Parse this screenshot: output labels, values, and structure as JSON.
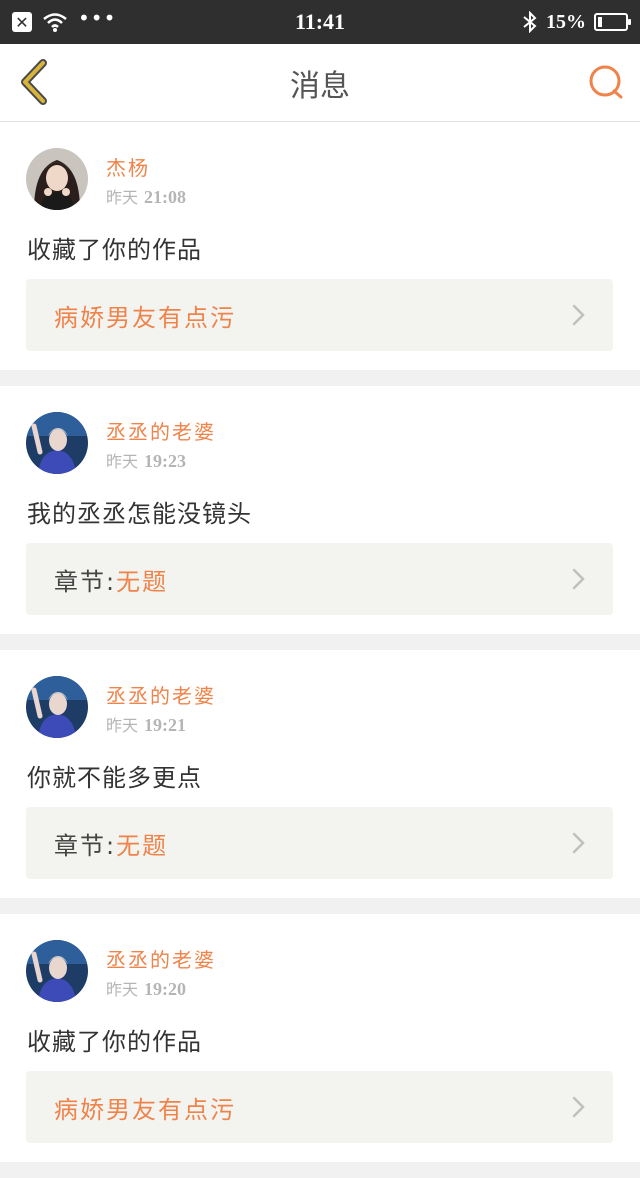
{
  "status_bar": {
    "time": "11:41",
    "battery": "15%",
    "battery_level": 0.15,
    "icons": [
      "close-box-icon",
      "wifi-icon",
      "more-dots-icon",
      "bluetooth-icon",
      "battery-icon"
    ]
  },
  "header": {
    "title": "消息",
    "back_icon": "chevron-left-icon",
    "search_icon": "search-icon"
  },
  "colors": {
    "accent": "#f0834a",
    "back_icon": "#d8b43a",
    "card_ref_bg": "#f3f3ef",
    "page_bg": "#f1f1f1"
  },
  "messages": [
    {
      "username": "杰杨",
      "day": "昨天",
      "time": "21:08",
      "text": "收藏了你的作品",
      "ref_prefix": "",
      "ref_title": "病娇男友有点污",
      "avatar": "girl-avatar"
    },
    {
      "username": "丞丞的老婆",
      "day": "昨天",
      "time": "19:23",
      "text": "我的丞丞怎能没镜头",
      "ref_prefix": "章节:",
      "ref_title": "无题",
      "avatar": "boy-blue-avatar"
    },
    {
      "username": "丞丞的老婆",
      "day": "昨天",
      "time": "19:21",
      "text": "你就不能多更点",
      "ref_prefix": "章节:",
      "ref_title": "无题",
      "avatar": "boy-blue-avatar"
    },
    {
      "username": "丞丞的老婆",
      "day": "昨天",
      "time": "19:20",
      "text": "收藏了你的作品",
      "ref_prefix": "",
      "ref_title": "病娇男友有点污",
      "avatar": "boy-blue-avatar"
    }
  ]
}
